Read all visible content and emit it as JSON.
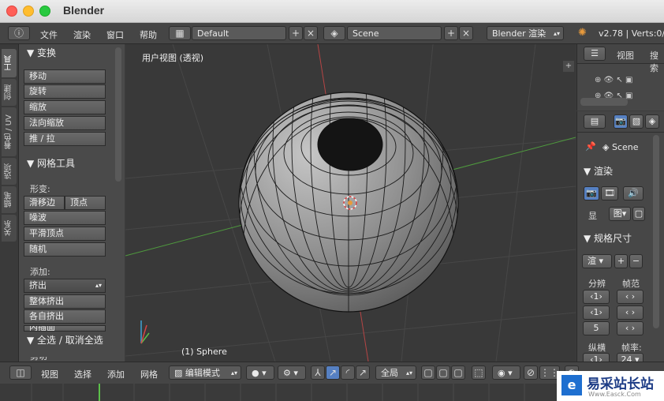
{
  "window": {
    "title": "Blender"
  },
  "info_header": {
    "menus": [
      "文件",
      "渲染",
      "窗口",
      "帮助"
    ],
    "layout": "Default",
    "scene": "Scene",
    "engine": "Blender 渲染",
    "version": "v2.78 | Verts:0/4"
  },
  "tool_tabs": [
    "工具",
    "创建",
    "着色 / UV",
    "选项",
    "蜡笔",
    "关系"
  ],
  "tool_shelf": {
    "transform_title": "变换",
    "transform_buttons": [
      "移动",
      "旋转",
      "缩放",
      "法向缩放",
      "推 / 拉"
    ],
    "mesh_tools_title": "网格工具",
    "deform_label": "形变:",
    "slide_edge": "滑移边",
    "slide_vertex": "顶点",
    "deform_buttons": [
      "噪波",
      "平滑顶点",
      "随机"
    ],
    "add_label": "添加:",
    "extrude": "挤出",
    "add_buttons": [
      "整体挤出",
      "各自挤出",
      "内插面"
    ],
    "select_panel": "全选 / 取消全选",
    "cut_label": "剪切"
  },
  "viewport": {
    "view_label": "用户视图 (透视)",
    "object_label": "(1) Sphere"
  },
  "outliner": {
    "view": "视图",
    "search": "搜索"
  },
  "properties": {
    "scene": "Scene",
    "render_title": "渲染",
    "display_label": "显",
    "display_value": "图",
    "dimensions_title": "规格尺寸",
    "preset": "渲",
    "resolution_label": "分辨",
    "resolution_values": [
      "1",
      "1",
      "5"
    ],
    "frame_range_label": "帧范",
    "aspect_label": "纵横",
    "aspect_value": "1",
    "framerate_label": "帧率:",
    "framerate_value": "24",
    "time_label": "时间"
  },
  "bottom_header": {
    "menus": [
      "视图",
      "选择",
      "添加",
      "网格"
    ],
    "mode": "编辑模式",
    "pivot": "全局"
  },
  "watermark": {
    "text": "易采站长站",
    "subtext": "Www.Easck.Com"
  },
  "colors": {
    "accent": "#5680c2",
    "mesh": "#9a9a9a",
    "x_axis": "#b54545",
    "y_axis": "#4f9a3e"
  }
}
